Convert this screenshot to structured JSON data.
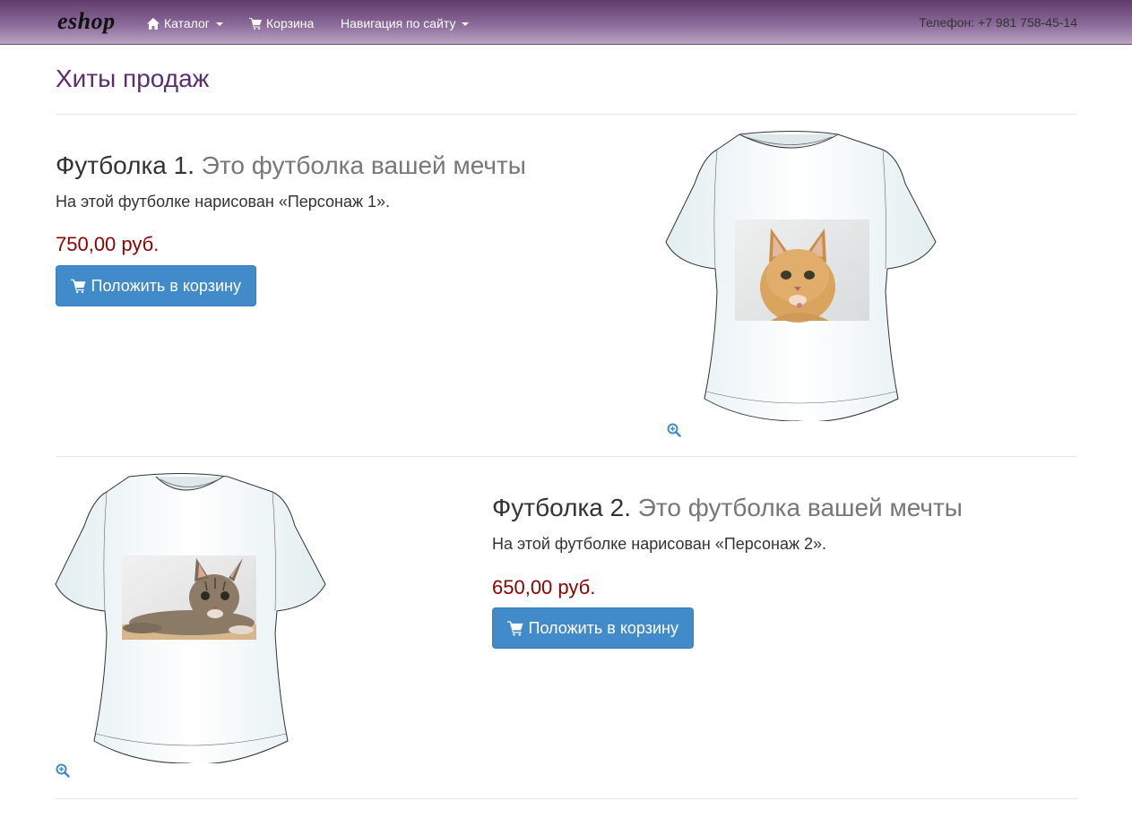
{
  "navbar": {
    "brand": "eshop",
    "catalog_label": "Каталог",
    "cart_label": "Корзина",
    "site_nav_label": "Навигация по сайту",
    "phone": "Телефон: +7 981 758-45-14"
  },
  "page": {
    "title": "Хиты продаж"
  },
  "products": [
    {
      "name": "Футболка 1.",
      "tagline": "Это футболка вашей мечты",
      "description": "На этой футболке нарисован «Персонаж 1».",
      "price": "750,00 руб.",
      "add_to_cart_label": "Положить в корзину"
    },
    {
      "name": "Футболка 2.",
      "tagline": "Это футболка вашей мечты",
      "description": "На этой футболке нарисован «Персонаж 2».",
      "price": "650,00 руб.",
      "add_to_cart_label": "Положить в корзину"
    }
  ],
  "colors": {
    "navbar_top": "#5f3b6c",
    "header_text": "#5b2f6b",
    "price_text": "#8b0000",
    "button_bg": "#428bca"
  },
  "icons": [
    "home-icon",
    "cart-icon",
    "zoom-in-icon",
    "caret-down-icon"
  ]
}
